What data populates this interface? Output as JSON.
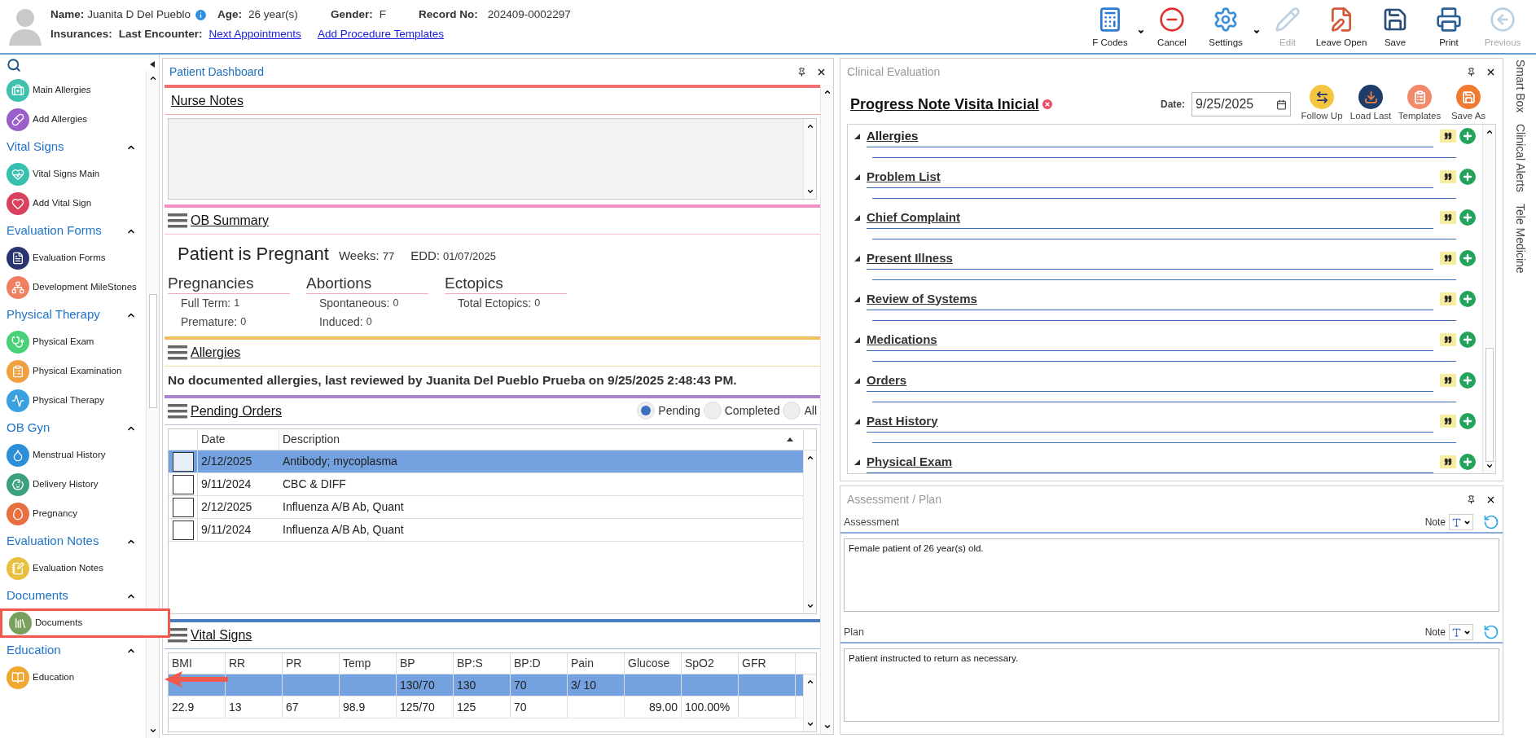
{
  "header": {
    "name_label": "Name:",
    "name": "Juanita D Del Pueblo",
    "age_label": "Age:",
    "age": "26 year(s)",
    "gender_label": "Gender:",
    "gender": "F",
    "record_label": "Record No:",
    "record": "202409-0002297",
    "insurances_label": "Insurances:",
    "last_encounter_label": "Last Encounter:",
    "links": [
      "Next Appointments",
      "Add Procedure Templates"
    ]
  },
  "toolbar": [
    {
      "label": "F Codes",
      "dropdown": true,
      "disabled": false
    },
    {
      "label": "Cancel",
      "dropdown": false,
      "disabled": false
    },
    {
      "label": "Settings",
      "dropdown": true,
      "disabled": false
    },
    {
      "label": "Edit",
      "dropdown": false,
      "disabled": true
    },
    {
      "label": "Leave Open",
      "dropdown": false,
      "disabled": false
    },
    {
      "label": "Save",
      "dropdown": false,
      "disabled": false
    },
    {
      "label": "Print",
      "dropdown": false,
      "disabled": false
    },
    {
      "label": "Previous",
      "dropdown": false,
      "disabled": true
    }
  ],
  "sidebar": {
    "top_items": [
      {
        "label": "Main Allergies",
        "highlighted": false
      },
      {
        "label": "Add Allergies",
        "highlighted": false
      }
    ],
    "sections": [
      {
        "title": "Vital Signs",
        "expanded": true,
        "items": [
          {
            "label": "Vital Signs Main",
            "highlighted": false
          },
          {
            "label": "Add Vital Sign",
            "highlighted": false
          }
        ]
      },
      {
        "title": "Evaluation Forms",
        "expanded": true,
        "items": [
          {
            "label": "Evaluation Forms",
            "highlighted": false
          },
          {
            "label": "Development MileStones",
            "highlighted": false
          }
        ]
      },
      {
        "title": "Physical Therapy",
        "expanded": true,
        "items": [
          {
            "label": "Physical Exam",
            "highlighted": false
          },
          {
            "label": "Physical Examination",
            "highlighted": false
          },
          {
            "label": "Physical Therapy",
            "highlighted": false
          }
        ]
      },
      {
        "title": "OB Gyn",
        "expanded": true,
        "items": [
          {
            "label": "Menstrual History",
            "highlighted": false
          },
          {
            "label": "Delivery History",
            "highlighted": false
          },
          {
            "label": "Pregnancy",
            "highlighted": false
          }
        ]
      },
      {
        "title": "Evaluation Notes",
        "expanded": true,
        "items": [
          {
            "label": "Evaluation Notes",
            "highlighted": false
          }
        ]
      },
      {
        "title": "Documents",
        "expanded": true,
        "items": [
          {
            "label": "Documents",
            "highlighted": true
          }
        ]
      },
      {
        "title": "Education",
        "expanded": true,
        "items": [
          {
            "label": "Education",
            "highlighted": false
          }
        ]
      }
    ]
  },
  "dashboard": {
    "title": "Patient Dashboard",
    "active": true,
    "sections": [
      {
        "kind": "notes",
        "heading": "Nurse Notes",
        "color": "#f07070",
        "menu_icon": false
      },
      {
        "kind": "ob",
        "heading": "OB Summary",
        "color": "#f48fc4",
        "menu_icon": true,
        "status": "Patient is Pregnant",
        "weeks_label": "Weeks:",
        "weeks": "77",
        "edd_label": "EDD:",
        "edd": "01/07/2025",
        "groups": [
          {
            "title": "Pregnancies",
            "lines": [
              {
                "label": "Full Term:",
                "value": "1"
              },
              {
                "label": "Premature:",
                "value": "0"
              }
            ]
          },
          {
            "title": "Abortions",
            "lines": [
              {
                "label": "Spontaneous:",
                "value": "0"
              },
              {
                "label": "Induced:",
                "value": "0"
              }
            ]
          },
          {
            "title": "Ectopics",
            "lines": [
              {
                "label": "Total Ectopics:",
                "value": "0"
              }
            ]
          }
        ]
      },
      {
        "kind": "allergies",
        "heading": "Allergies",
        "color": "#f0c060",
        "menu_icon": true,
        "summary": "No documented allergies, last reviewed by Juanita Del Pueblo Prueba on 9/25/2025 2:48:43 PM."
      },
      {
        "kind": "orders",
        "heading": "Pending Orders",
        "color": "#a884cc",
        "menu_icon": true,
        "filters": [
          {
            "label": "Pending",
            "selected": true
          },
          {
            "label": "Completed",
            "selected": false
          },
          {
            "label": "All",
            "selected": false
          }
        ],
        "columns": [
          "Date",
          "Description"
        ],
        "rows": [
          {
            "date": "2/12/2025",
            "description": "Antibody; mycoplasma",
            "selected": true,
            "checked": false
          },
          {
            "date": "9/11/2024",
            "description": "CBC & DIFF",
            "selected": false,
            "checked": false
          },
          {
            "date": "2/12/2025",
            "description": "Influenza A/B Ab, Quant",
            "selected": false,
            "checked": false
          },
          {
            "date": "9/11/2024",
            "description": "Influenza A/B Ab, Quant",
            "selected": false,
            "checked": false
          }
        ]
      },
      {
        "kind": "vitals",
        "heading": "Vital Signs",
        "color": "#4a7cc0",
        "menu_icon": true,
        "columns": [
          "BMI",
          "RR",
          "PR",
          "Temp",
          "BP",
          "BP:S",
          "BP:D",
          "Pain",
          "Glucose",
          "SpO2",
          "GFR"
        ],
        "rows": [
          {
            "selected": true,
            "cells": [
              null,
              null,
              null,
              null,
              "130/70",
              "130",
              "70",
              "3/ 10",
              null,
              null,
              null
            ]
          },
          {
            "selected": false,
            "cells": [
              "22.9",
              "13",
              "67",
              "98.9",
              "125/70",
              "125",
              "70",
              null,
              "89.00",
              "100.00%",
              null
            ]
          }
        ]
      }
    ]
  },
  "clinical": {
    "title": "Clinical Evaluation",
    "active": false,
    "note_title": "Progress Note Visita Inicial",
    "date_label": "Date:",
    "date": "9/25/2025",
    "actions": [
      "Follow Up",
      "Load Last",
      "Templates",
      "Save As"
    ],
    "sections": [
      "Allergies",
      "Problem List",
      "Chief Complaint",
      "Present Illness",
      "Review of Systems",
      "Medications",
      "Orders",
      "Past History",
      "Physical Exam"
    ]
  },
  "assessment": {
    "title": "Assessment / Plan",
    "active": false,
    "fields": [
      {
        "label": "Assessment",
        "note_label": "Note",
        "value": "Female patient of 26 year(s) old."
      },
      {
        "label": "Plan",
        "note_label": "Note",
        "value": "Patient instructed to return as necessary."
      }
    ]
  },
  "side_tabs": [
    "Smart Box",
    "Clinical Alerts",
    "Tele Medicine"
  ]
}
